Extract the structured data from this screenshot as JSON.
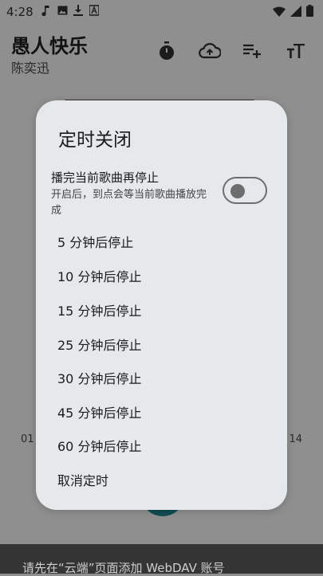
{
  "status_bar": {
    "time": "4:28",
    "left_icons": [
      "music-note-icon",
      "image-icon",
      "download-icon",
      "app-a-icon"
    ],
    "right_icons": [
      "wifi-icon",
      "signal-icon",
      "battery-icon"
    ]
  },
  "header": {
    "title": "愚人快乐",
    "subtitle": "陈奕迅",
    "actions": [
      "timer-icon",
      "cloud-upload-icon",
      "playlist-add-icon",
      "text-size-icon"
    ]
  },
  "player": {
    "elapsed": "01",
    "duration": "14"
  },
  "bottom_bar": {
    "message": "请先在“云端”页面添加 WebDAV 账号"
  },
  "dialog": {
    "title": "定时关闭",
    "finish_song": {
      "label": "播完当前歌曲再停止",
      "description": "开启后，到点会等当前歌曲播放完成",
      "enabled": false
    },
    "options": [
      {
        "label": "5 分钟后停止"
      },
      {
        "label": "10 分钟后停止"
      },
      {
        "label": "15 分钟后停止"
      },
      {
        "label": "25 分钟后停止"
      },
      {
        "label": "30 分钟后停止"
      },
      {
        "label": "45 分钟后停止"
      },
      {
        "label": "60 分钟后停止"
      },
      {
        "label": "取消定时"
      }
    ]
  },
  "colors": {
    "scrim": "#8f8f8f",
    "dialog_bg": "#e6e9ec",
    "play_button": "#0f4d52",
    "bottom_bar": "#353535"
  }
}
